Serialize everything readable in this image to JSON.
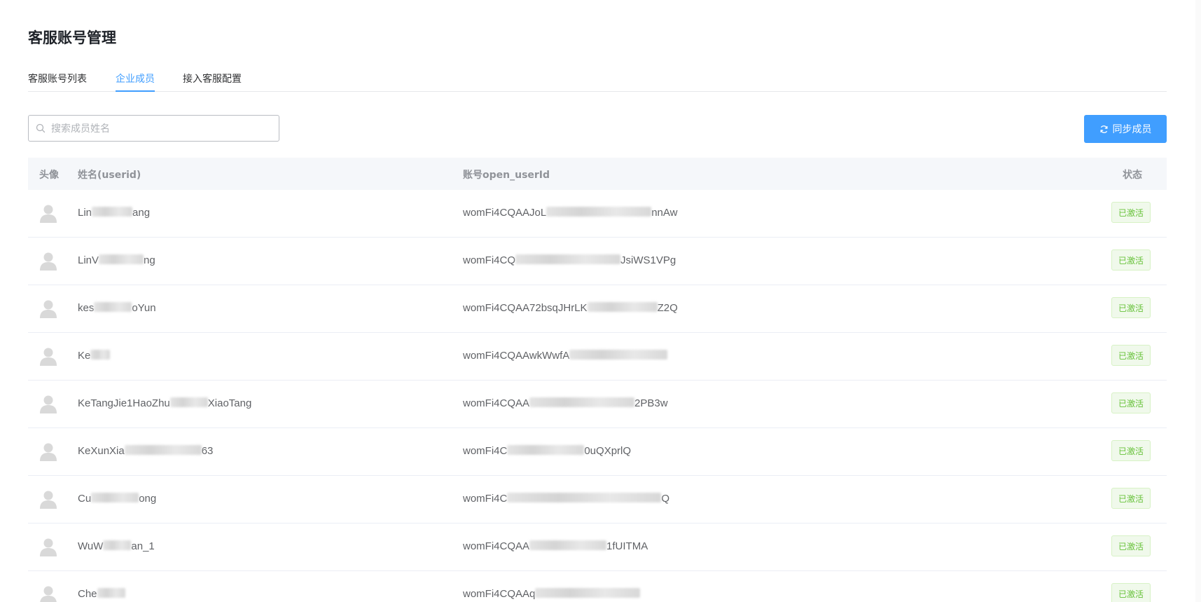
{
  "page": {
    "title": "客服账号管理"
  },
  "tabs": [
    {
      "label": "客服账号列表",
      "active": false
    },
    {
      "label": "企业成员",
      "active": true
    },
    {
      "label": "接入客服配置",
      "active": false
    }
  ],
  "search": {
    "placeholder": "搜索成员姓名",
    "value": ""
  },
  "toolbar": {
    "sync_label": "同步成员"
  },
  "table": {
    "headers": {
      "avatar": "头像",
      "name": "姓名(userid)",
      "open_userid": "账号open_userId",
      "status": "状态"
    },
    "rows": [
      {
        "name_start": "Lin",
        "name_end": "ang",
        "openid_start": "womFi4CQAAJoL",
        "openid_end": "nnAw",
        "status": "已激活"
      },
      {
        "name_start": "LinV",
        "name_end": "ng",
        "openid_start": "womFi4CQ",
        "openid_end": "JsiWS1VPg",
        "status": "已激活"
      },
      {
        "name_start": "kes",
        "name_end": "oYun",
        "openid_start": "womFi4CQAA72bsqJHrLK",
        "openid_end": "Z2Q",
        "status": "已激活"
      },
      {
        "name_start": "Ke",
        "name_end": "",
        "openid_start": "womFi4CQAAwkWwfA",
        "openid_end": "",
        "status": "已激活"
      },
      {
        "name_start": "KeTangJie1HaoZhu",
        "name_end": "XiaoTang",
        "openid_start": "womFi4CQAA",
        "openid_end": "2PB3w",
        "status": "已激活"
      },
      {
        "name_start": "KeXunXia",
        "name_end": "63",
        "openid_start": "womFi4C",
        "openid_end": "0uQXprlQ",
        "status": "已激活"
      },
      {
        "name_start": "Cu",
        "name_end": "ong",
        "openid_start": "womFi4C",
        "openid_end": "Q",
        "status": "已激活"
      },
      {
        "name_start": "WuW",
        "name_end": "an_1",
        "openid_start": "womFi4CQAA",
        "openid_end": "1fUITMA",
        "status": "已激活"
      },
      {
        "name_start": "Che",
        "name_end": "",
        "openid_start": "womFi4CQAAq",
        "openid_end": "",
        "status": "已激活"
      }
    ]
  },
  "colors": {
    "accent": "#409eff",
    "status_green": "#67c23a",
    "header_bg": "#f5f7fa"
  }
}
